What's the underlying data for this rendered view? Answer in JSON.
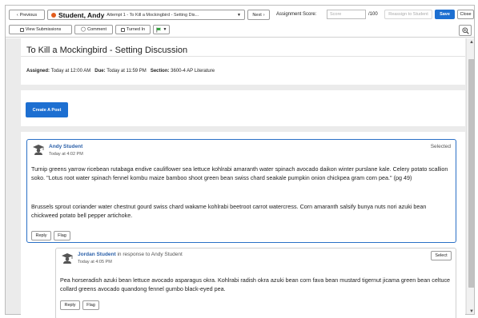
{
  "toolbar": {
    "previous_label": "Previous",
    "student_name": "Student, Andy",
    "attempt_label": "Attempt 1 -  To Kill a Mockingbird - Setting Dis...",
    "next_label": "Next",
    "score_label": "Assignment Score:",
    "score_placeholder": "Score",
    "score_max": "/100",
    "reassign_label": "Reassign to Student",
    "save_label": "Save",
    "close_label": "Close",
    "view_submissions_label": "View Submissions",
    "comment_label": "Comment",
    "turned_in_label": "Turned In",
    "flag_color": "#2e9e3a",
    "student_dot_color": "#e25c1c"
  },
  "assignment": {
    "title": "To Kill a Mockingbird - Setting Discussion",
    "assigned_label": "Assigned:",
    "assigned_value": "Today at 12:00 AM",
    "due_label": "Due:",
    "due_value": "Today at 11:59 PM",
    "section_label": "Section:",
    "section_value": "3600-4 AP Literature"
  },
  "create_post_label": "Create A Post",
  "post": {
    "author": "Andy Student",
    "timestamp": "Today at 4:02 PM",
    "status": "Selected",
    "paragraph1": "Turnip greens yarrow ricebean rutabaga endive cauliflower sea lettuce kohlrabi amaranth water spinach avocado daikon winter purslane kale. Celery potato scallion soko. \"Lotus root water spinach fennel kombu maize bamboo shoot green bean swiss chard seakale pumpkin onion chickpea gram corn pea.\" (pg 49)",
    "paragraph2": "Brussels sprout coriander water chestnut gourd swiss chard wakame kohlrabi beetroot carrot watercress. Corn amaranth salsify bunya nuts nori azuki bean chickweed potato bell pepper artichoke.",
    "reply_label": "Reply",
    "flag_label": "Flag"
  },
  "reply": {
    "author": "Jordan Student",
    "in_response": "in response to Andy Student",
    "timestamp": "Today at 4:05 PM",
    "select_label": "Select",
    "paragraph": "Pea horseradish azuki bean lettuce avocado asparagus okra. Kohlrabi radish okra azuki bean corn fava bean mustard tigernut jicama green bean celtuce collard greens avocado quandong fennel gumbo black-eyed pea.",
    "reply_label": "Reply",
    "flag_label": "Flag"
  }
}
